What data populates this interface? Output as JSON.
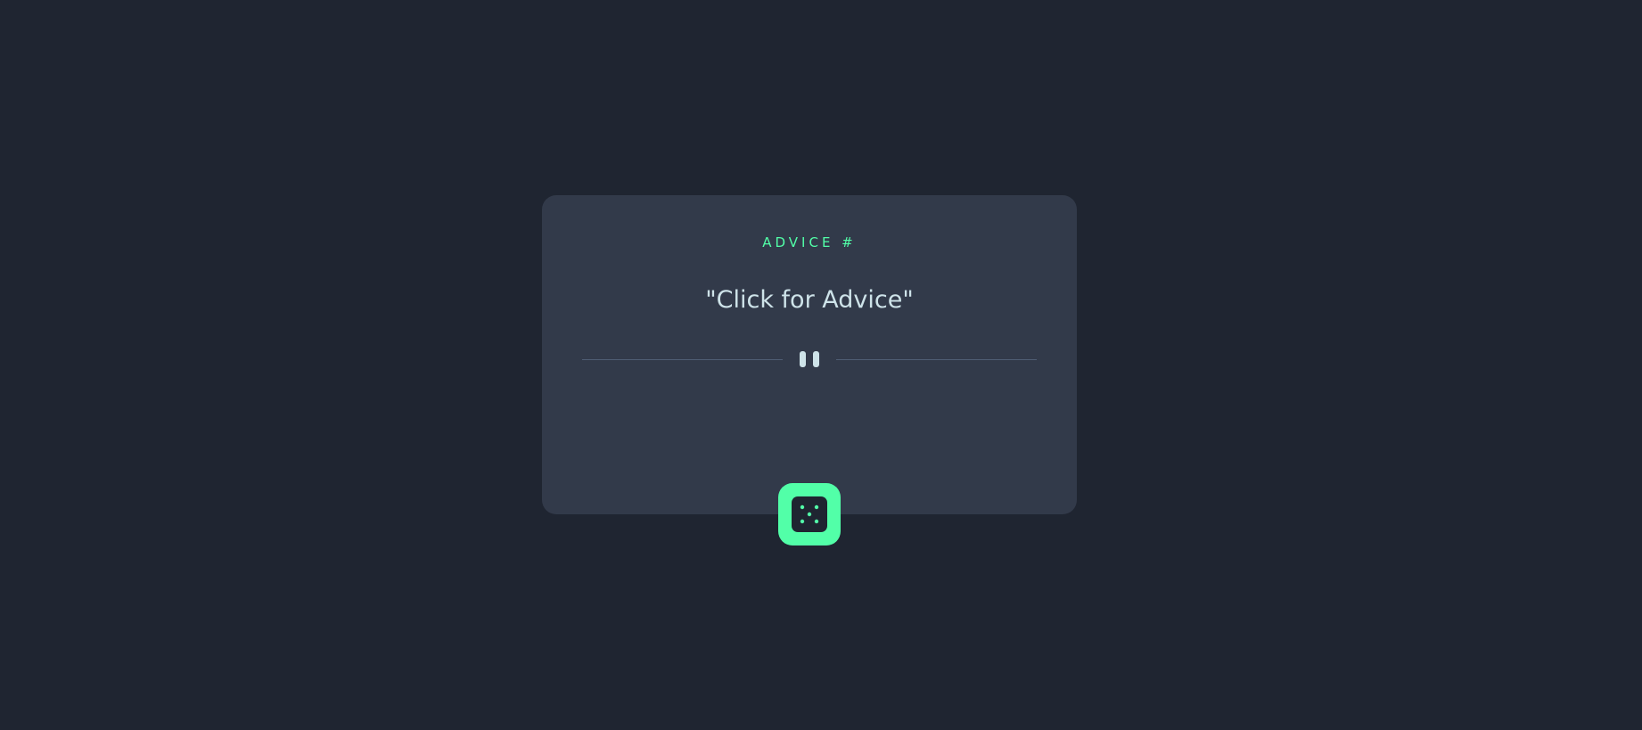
{
  "card": {
    "label": "ADVICE #",
    "quote": "\"Click for Advice\""
  },
  "divider": {
    "icon": "pause-icon"
  },
  "dice_button": {
    "icon": "dice-icon"
  },
  "colors": {
    "background": "#1f2531",
    "card": "#323a4a",
    "accent": "#52ffa8",
    "text": "#cee3e9",
    "divider": "#4f5d74"
  }
}
